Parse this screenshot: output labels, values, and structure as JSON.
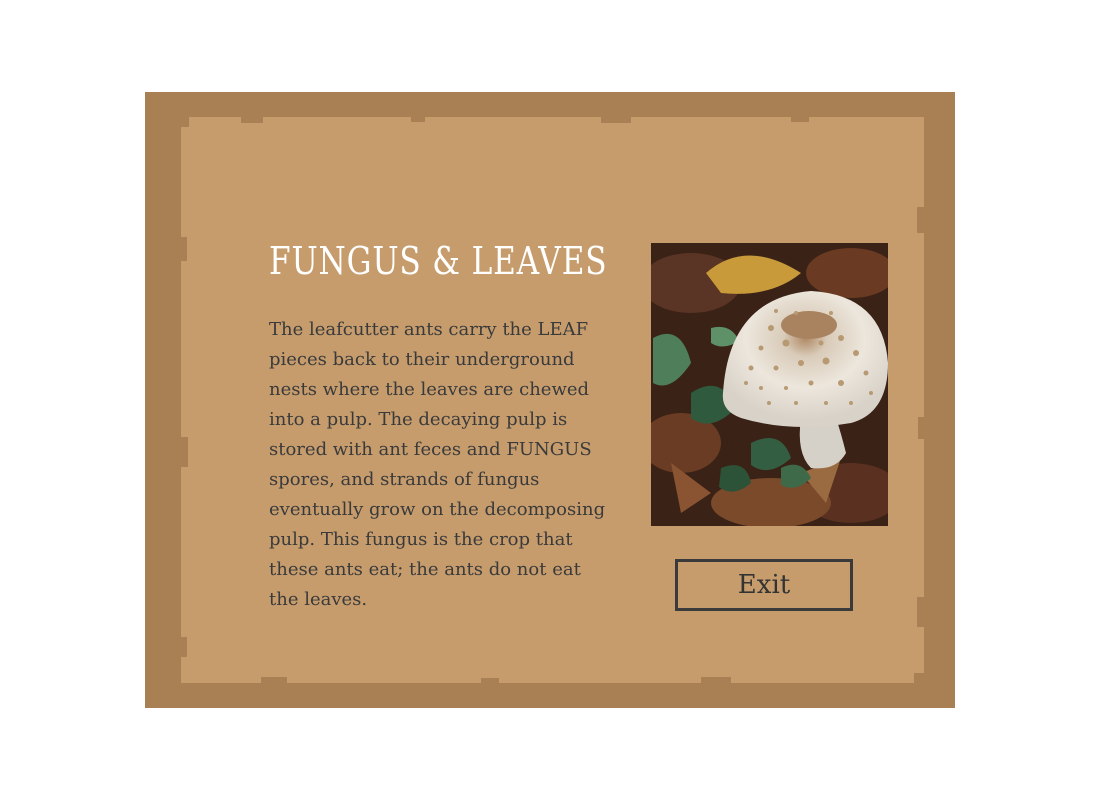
{
  "dialog": {
    "title": "FUNGUS & LEAVES",
    "body": "The leafcutter ants carry the LEAF pieces back to their underground nests where the leaves are chewed into a pulp. The decaying pulp is stored with ant feces and FUNGUS spores, and strands of fungus eventually grow on the decomposing pulp. This fungus is the crop that these ants eat; the ants do not eat the leaves.",
    "exit_label": "Exit",
    "image_subject": "mushroom-photo"
  },
  "colors": {
    "frame_outer": "#a97f54",
    "frame_inner": "#c69c6d",
    "title": "#ffffff",
    "text": "#3a3a3a",
    "button_border": "#3a3a3a"
  }
}
